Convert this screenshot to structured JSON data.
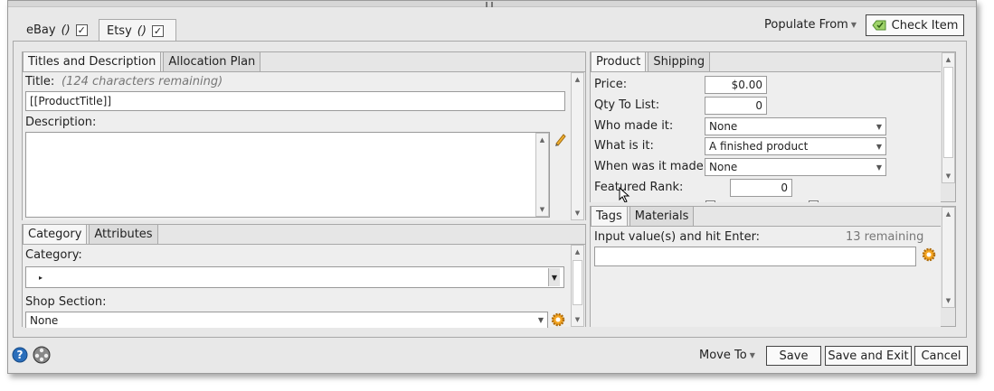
{
  "top_tabs": [
    {
      "label": "eBay",
      "suffix": "()",
      "checked": true
    },
    {
      "label": "Etsy",
      "suffix": "()",
      "checked": true
    }
  ],
  "header": {
    "populate_from": "Populate From",
    "check_item": "Check Item"
  },
  "titles_panel": {
    "tabs": [
      "Titles and Description",
      "Allocation Plan"
    ],
    "title_label": "Title:",
    "title_hint": "(124 characters remaining)",
    "title_value": "[[ProductTitle]]",
    "description_label": "Description:",
    "description_value": ""
  },
  "category_panel": {
    "tabs": [
      "Category",
      "Attributes"
    ],
    "category_label": "Category:",
    "category_value": "",
    "shop_section_label": "Shop Section:",
    "shop_section_value": "None"
  },
  "product_panel": {
    "tabs": [
      "Product",
      "Shipping"
    ],
    "price_label": "Price:",
    "price_value": "$0.00",
    "qty_label": "Qty To List:",
    "qty_value": "0",
    "who_label": "Who made it:",
    "who_value": "None",
    "what_label": "What is it:",
    "what_value": "A finished product",
    "when_label": "When was it made:",
    "when_value": "None",
    "rank_label": "Featured Rank:",
    "rank_value": "0"
  },
  "tags_panel": {
    "tabs": [
      "Tags",
      "Materials"
    ],
    "input_label": "Input value(s) and hit Enter:",
    "remaining": "13 remaining",
    "input_value": ""
  },
  "footer": {
    "move_to": "Move To",
    "save": "Save",
    "save_exit": "Save and Exit",
    "cancel": "Cancel"
  },
  "colors": {
    "accent": "#6aa84f",
    "gear": "#f0a020",
    "help": "#2a6ebb"
  }
}
